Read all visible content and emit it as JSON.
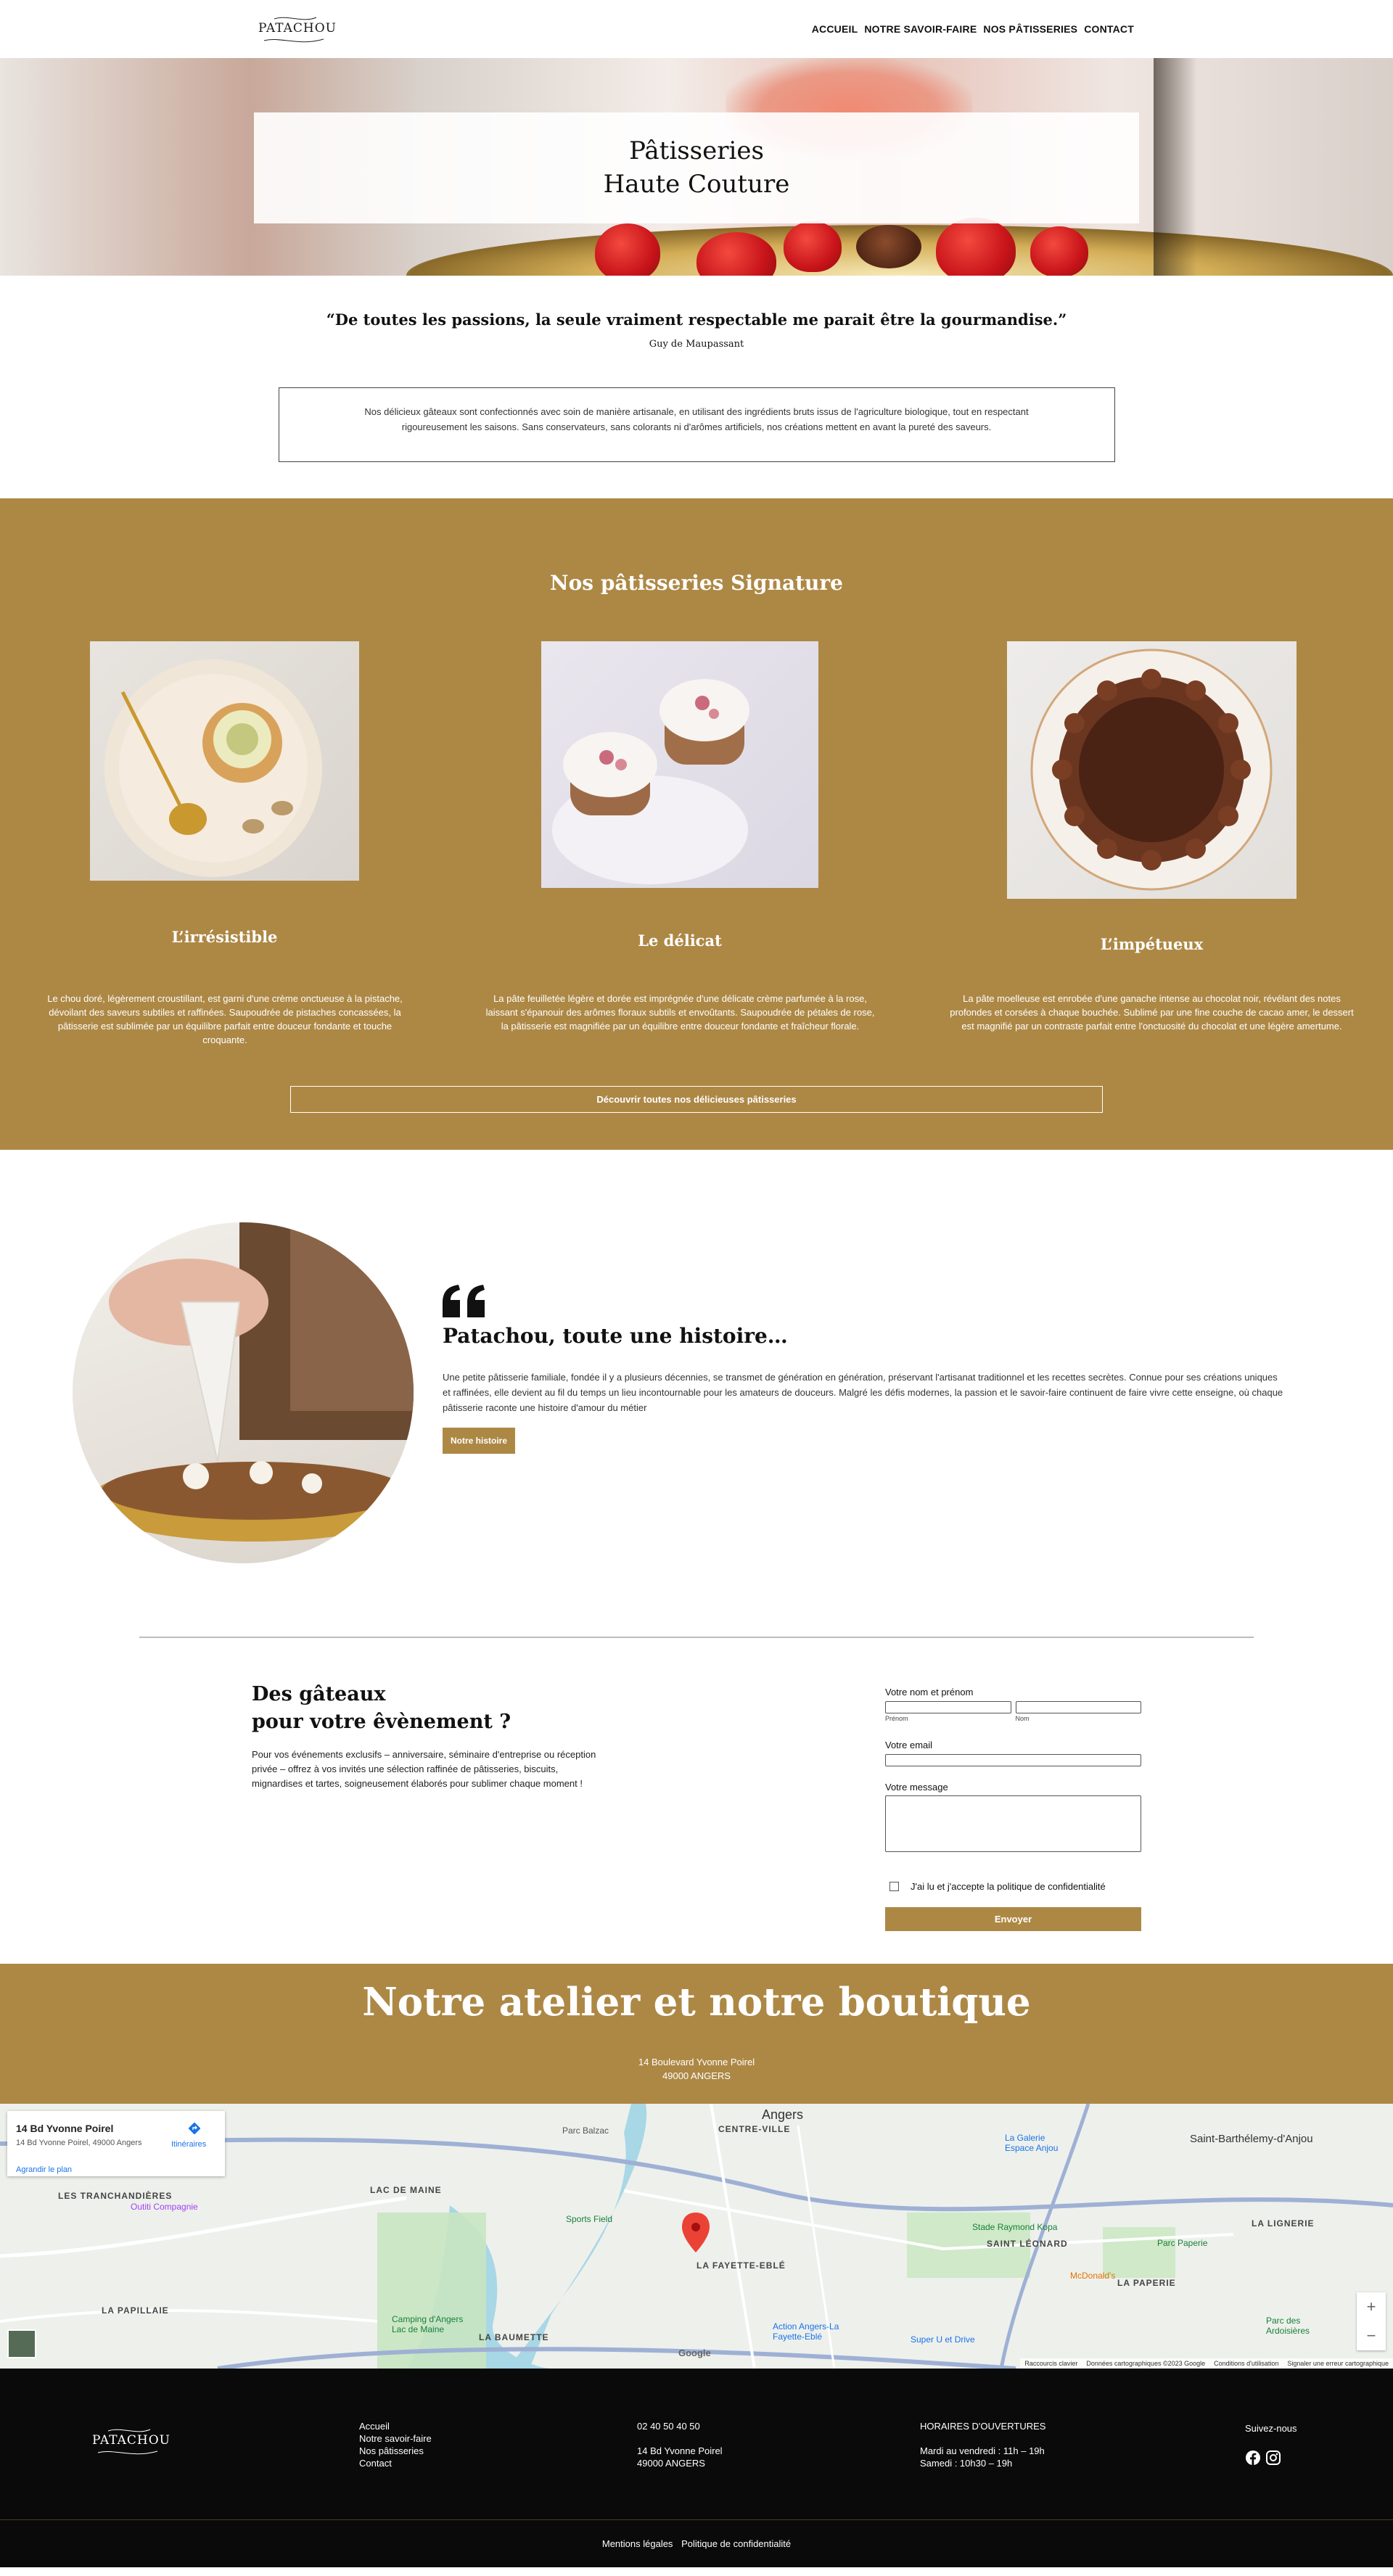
{
  "brand": {
    "logo_text": "PATACHOU"
  },
  "nav": {
    "items": [
      "ACCUEIL",
      "NOTRE SAVOIR-FAIRE",
      "NOS PÂTISSERIES",
      "CONTACT"
    ]
  },
  "hero": {
    "line1": "Pâtisseries",
    "line2": "Haute Couture"
  },
  "quote": {
    "text": "“De toutes les passions, la seule vraiment respectable me parait être la gourmandise.”",
    "author": "Guy de Maupassant"
  },
  "intro": {
    "text": "Nos délicieux gâteaux sont confectionnés avec soin de manière artisanale, en utilisant des ingrédients bruts issus de l'agriculture biologique, tout en respectant rigoureusement les saisons. Sans conservateurs, sans colorants ni d'arômes artificiels, nos créations mettent en avant la pureté des saveurs."
  },
  "signature": {
    "title": "Nos pâtisseries Signature",
    "items": [
      {
        "name": "L’irrésistible",
        "desc": "Le chou doré, légèrement croustillant, est garni d'une crème onctueuse à la pistache, dévoilant des saveurs subtiles et raffinées. Saupoudrée de pistaches concassées, la pâtisserie est sublimée par un équilibre parfait entre douceur fondante et touche croquante."
      },
      {
        "name": "Le délicat",
        "desc": "La pâte feuilletée légère et dorée est imprégnée d'une délicate crème parfumée à la rose, laissant s'épanouir des arômes floraux subtils et envoûtants. Saupoudrée de pétales de rose, la pâtisserie est magnifiée par un équilibre entre douceur fondante et fraîcheur florale."
      },
      {
        "name": "L’impétueux",
        "desc": "La pâte moelleuse est enrobée d'une ganache intense au chocolat noir, révélant des notes profondes et corsées à chaque bouchée. Sublimé par une fine couche de cacao amer, le dessert est magnifié par un contraste parfait entre l'onctuosité du chocolat et une légère amertume."
      }
    ],
    "button": "Découvrir toutes nos délicieuses pâtisseries"
  },
  "story": {
    "title": "Patachou, toute une histoire…",
    "text": "Une petite pâtisserie familiale, fondée il y a plusieurs décennies, se transmet de génération en génération, préservant l'artisanat traditionnel et les recettes secrètes. Connue pour ses créations uniques et raffinées, elle devient au fil du temps un lieu incontournable pour les amateurs de douceurs. Malgré les défis modernes, la passion et le savoir-faire continuent de faire vivre cette enseigne, où chaque pâtisserie raconte une histoire d'amour du métier",
    "button": "Notre histoire"
  },
  "event": {
    "title_line1": "Des gâteaux",
    "title_line2": "pour votre êvènement ?",
    "text": "Pour vos événements exclusifs – anniversaire, séminaire d'entreprise ou réception privée – offrez à vos invités une sélection raffinée de pâtisseries, biscuits, mignardises et tartes, soigneusement élaborés pour sublimer chaque moment !"
  },
  "form": {
    "name_label": "Votre nom et prénom",
    "first_sub": "Prénom",
    "last_sub": "Nom",
    "email_label": "Votre email",
    "message_label": "Votre message",
    "consent": "J'ai lu et j'accepte la politique de confidentialité",
    "submit": "Envoyer"
  },
  "workshop": {
    "title": "Notre atelier et notre boutique",
    "address1": "14 Boulevard Yvonne Poirel",
    "address2": "49000 ANGERS"
  },
  "map": {
    "card_name": "14 Bd Yvonne Poirel",
    "card_address": "14 Bd Yvonne Poirel, 49000 Angers",
    "card_enlarge": "Agrandir le plan",
    "card_itineraries": "Itinéraires",
    "labels": [
      "Angers",
      "CENTRE-VILLE",
      "Saint-Barthélemy-d'Anjou",
      "LES TRANCHANDIÈRES",
      "LAC DE MAINE",
      "LA FAYETTE-EBLÉ",
      "SAINT LÉONARD",
      "LA LIGNERIE",
      "LA PAPERIE",
      "LA PAPILLAIE",
      "LA BAUMETTE",
      "Parc Balzac",
      "Sports Field",
      "Stade Raymond Kopa",
      "McDonald's",
      "Action Angers-La Fayette-Eblé",
      "Super U et Drive",
      "La Galerie Espace Anjou",
      "Outiti Compagnie",
      "Camping d'Angers Lac de Maine",
      "Parc Paperie",
      "Parc des Ardoisières"
    ],
    "google": "Google",
    "footer": [
      "Raccourcis clavier",
      "Données cartographiques ©2023 Google",
      "Conditions d'utilisation",
      "Signaler une erreur cartographique"
    ],
    "zoom_in": "+",
    "zoom_out": "−"
  },
  "footer": {
    "links": [
      "Accueil",
      "Notre savoir-faire",
      "Nos pâtisseries",
      "Contact"
    ],
    "phone": "02 40 50 40 50",
    "address1": "14 Bd Yvonne Poirel",
    "address2": "49000 ANGERS",
    "hours_title": "HORAIRES D'OUVERTURES",
    "hours1": "Mardi au vendredi : 11h – 19h",
    "hours2": "Samedi : 10h30 – 19h",
    "follow": "Suivez-nous",
    "bottom": [
      "Mentions légales",
      "Politique de confidentialité"
    ]
  },
  "colors": {
    "accent": "#ad8845",
    "footer_bg": "#0a0a0a"
  }
}
